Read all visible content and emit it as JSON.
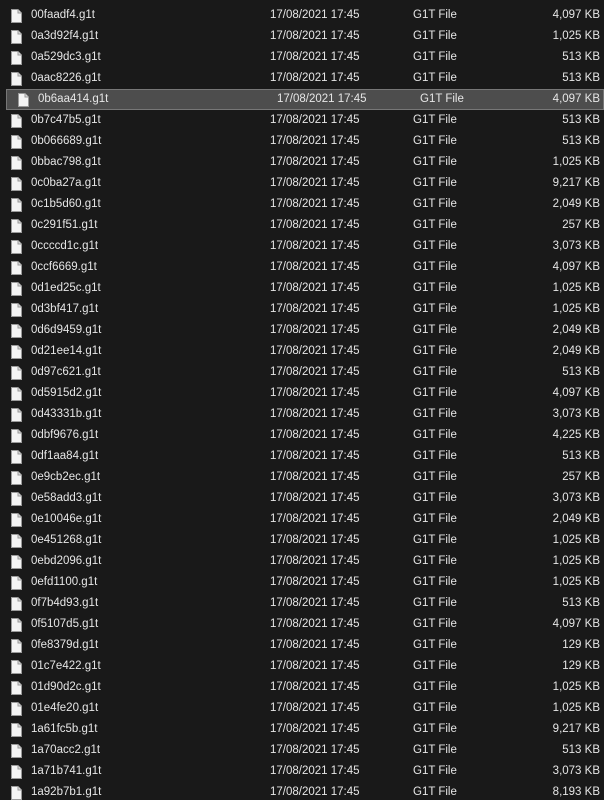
{
  "colors": {
    "background": "#191919",
    "text": "#e6e6e6",
    "selected_row": "#4d4d4d",
    "selected_border": "#777777"
  },
  "icon": "file-icon",
  "files": [
    {
      "name": "00faadf4.g1t",
      "date": "17/08/2021 17:45",
      "type": "G1T File",
      "size": "4,097 KB"
    },
    {
      "name": "0a3d92f4.g1t",
      "date": "17/08/2021 17:45",
      "type": "G1T File",
      "size": "1,025 KB"
    },
    {
      "name": "0a529dc3.g1t",
      "date": "17/08/2021 17:45",
      "type": "G1T File",
      "size": "513 KB"
    },
    {
      "name": "0aac8226.g1t",
      "date": "17/08/2021 17:45",
      "type": "G1T File",
      "size": "513 KB"
    },
    {
      "name": "0b6aa414.g1t",
      "date": "17/08/2021 17:45",
      "type": "G1T File",
      "size": "4,097 KB",
      "selected": true
    },
    {
      "name": "0b7c47b5.g1t",
      "date": "17/08/2021 17:45",
      "type": "G1T File",
      "size": "513 KB"
    },
    {
      "name": "0b066689.g1t",
      "date": "17/08/2021 17:45",
      "type": "G1T File",
      "size": "513 KB"
    },
    {
      "name": "0bbac798.g1t",
      "date": "17/08/2021 17:45",
      "type": "G1T File",
      "size": "1,025 KB"
    },
    {
      "name": "0c0ba27a.g1t",
      "date": "17/08/2021 17:45",
      "type": "G1T File",
      "size": "9,217 KB"
    },
    {
      "name": "0c1b5d60.g1t",
      "date": "17/08/2021 17:45",
      "type": "G1T File",
      "size": "2,049 KB"
    },
    {
      "name": "0c291f51.g1t",
      "date": "17/08/2021 17:45",
      "type": "G1T File",
      "size": "257 KB"
    },
    {
      "name": "0ccccd1c.g1t",
      "date": "17/08/2021 17:45",
      "type": "G1T File",
      "size": "3,073 KB"
    },
    {
      "name": "0ccf6669.g1t",
      "date": "17/08/2021 17:45",
      "type": "G1T File",
      "size": "4,097 KB"
    },
    {
      "name": "0d1ed25c.g1t",
      "date": "17/08/2021 17:45",
      "type": "G1T File",
      "size": "1,025 KB"
    },
    {
      "name": "0d3bf417.g1t",
      "date": "17/08/2021 17:45",
      "type": "G1T File",
      "size": "1,025 KB"
    },
    {
      "name": "0d6d9459.g1t",
      "date": "17/08/2021 17:45",
      "type": "G1T File",
      "size": "2,049 KB"
    },
    {
      "name": "0d21ee14.g1t",
      "date": "17/08/2021 17:45",
      "type": "G1T File",
      "size": "2,049 KB"
    },
    {
      "name": "0d97c621.g1t",
      "date": "17/08/2021 17:45",
      "type": "G1T File",
      "size": "513 KB"
    },
    {
      "name": "0d5915d2.g1t",
      "date": "17/08/2021 17:45",
      "type": "G1T File",
      "size": "4,097 KB"
    },
    {
      "name": "0d43331b.g1t",
      "date": "17/08/2021 17:45",
      "type": "G1T File",
      "size": "3,073 KB"
    },
    {
      "name": "0dbf9676.g1t",
      "date": "17/08/2021 17:45",
      "type": "G1T File",
      "size": "4,225 KB"
    },
    {
      "name": "0df1aa84.g1t",
      "date": "17/08/2021 17:45",
      "type": "G1T File",
      "size": "513 KB"
    },
    {
      "name": "0e9cb2ec.g1t",
      "date": "17/08/2021 17:45",
      "type": "G1T File",
      "size": "257 KB"
    },
    {
      "name": "0e58add3.g1t",
      "date": "17/08/2021 17:45",
      "type": "G1T File",
      "size": "3,073 KB"
    },
    {
      "name": "0e10046e.g1t",
      "date": "17/08/2021 17:45",
      "type": "G1T File",
      "size": "2,049 KB"
    },
    {
      "name": "0e451268.g1t",
      "date": "17/08/2021 17:45",
      "type": "G1T File",
      "size": "1,025 KB"
    },
    {
      "name": "0ebd2096.g1t",
      "date": "17/08/2021 17:45",
      "type": "G1T File",
      "size": "1,025 KB"
    },
    {
      "name": "0efd1100.g1t",
      "date": "17/08/2021 17:45",
      "type": "G1T File",
      "size": "1,025 KB"
    },
    {
      "name": "0f7b4d93.g1t",
      "date": "17/08/2021 17:45",
      "type": "G1T File",
      "size": "513 KB"
    },
    {
      "name": "0f5107d5.g1t",
      "date": "17/08/2021 17:45",
      "type": "G1T File",
      "size": "4,097 KB"
    },
    {
      "name": "0fe8379d.g1t",
      "date": "17/08/2021 17:45",
      "type": "G1T File",
      "size": "129 KB"
    },
    {
      "name": "01c7e422.g1t",
      "date": "17/08/2021 17:45",
      "type": "G1T File",
      "size": "129 KB"
    },
    {
      "name": "01d90d2c.g1t",
      "date": "17/08/2021 17:45",
      "type": "G1T File",
      "size": "1,025 KB"
    },
    {
      "name": "01e4fe20.g1t",
      "date": "17/08/2021 17:45",
      "type": "G1T File",
      "size": "1,025 KB"
    },
    {
      "name": "1a61fc5b.g1t",
      "date": "17/08/2021 17:45",
      "type": "G1T File",
      "size": "9,217 KB"
    },
    {
      "name": "1a70acc2.g1t",
      "date": "17/08/2021 17:45",
      "type": "G1T File",
      "size": "513 KB"
    },
    {
      "name": "1a71b741.g1t",
      "date": "17/08/2021 17:45",
      "type": "G1T File",
      "size": "3,073 KB"
    },
    {
      "name": "1a92b7b1.g1t",
      "date": "17/08/2021 17:45",
      "type": "G1T File",
      "size": "8,193 KB"
    }
  ]
}
